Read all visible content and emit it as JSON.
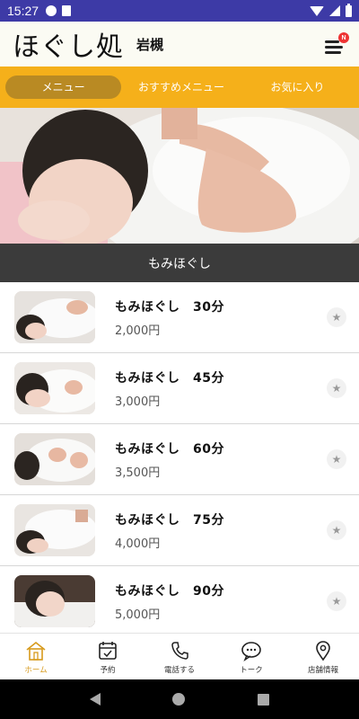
{
  "status_bar": {
    "time": "15:27"
  },
  "header": {
    "brand": "ほぐし処",
    "store": "岩槻",
    "menu_badge": "N"
  },
  "tabs": [
    {
      "label": "メニュー",
      "active": true
    },
    {
      "label": "おすすめメニュー",
      "active": false
    },
    {
      "label": "お気に入り",
      "active": false
    }
  ],
  "hero": {
    "caption": "もみほぐし"
  },
  "menu_items": [
    {
      "name": "もみほぐし　30分",
      "price": "2,000円"
    },
    {
      "name": "もみほぐし　45分",
      "price": "3,000円"
    },
    {
      "name": "もみほぐし　60分",
      "price": "3,500円"
    },
    {
      "name": "もみほぐし　75分",
      "price": "4,000円"
    },
    {
      "name": "もみほぐし　90分",
      "price": "5,000円"
    }
  ],
  "bottom_nav": [
    {
      "label": "ホーム",
      "icon": "home-icon",
      "active": true
    },
    {
      "label": "予約",
      "icon": "calendar-icon",
      "active": false
    },
    {
      "label": "電話する",
      "icon": "phone-icon",
      "active": false
    },
    {
      "label": "トーク",
      "icon": "chat-icon",
      "active": false
    },
    {
      "label": "店舗情報",
      "icon": "map-pin-icon",
      "active": false
    }
  ],
  "colors": {
    "accent": "#f5b01a",
    "tab_active": "#b98a23",
    "status_bar": "#3d3aa6",
    "caption_bar": "#3b3b3b"
  }
}
